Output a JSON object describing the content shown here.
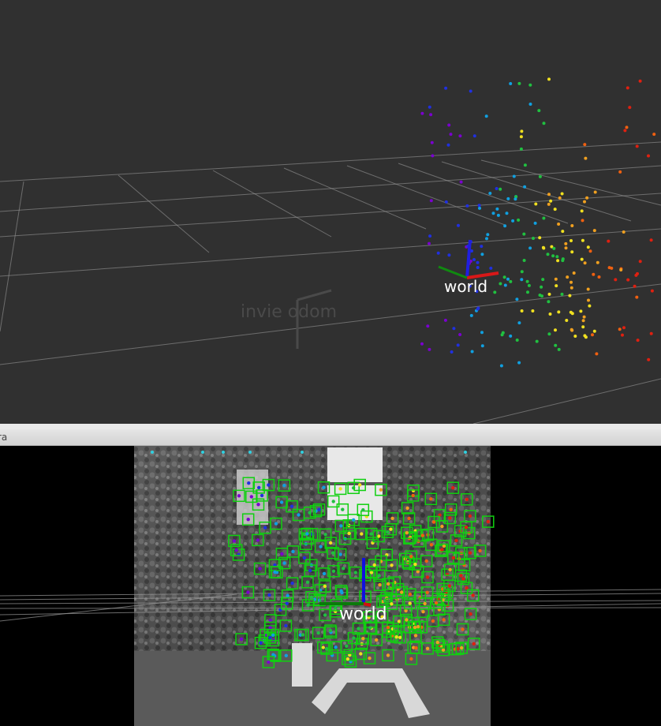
{
  "viewport": {
    "background": "#303030",
    "grid_color": "#a0a0a0",
    "watermark_text": "invie  odom",
    "frame_label": "world",
    "axis_colors": {
      "x": "#e01010",
      "y": "#10a010",
      "z": "#1010e0"
    },
    "point_palette": [
      "#7a00d0",
      "#2030e0",
      "#10a0e0",
      "#20c040",
      "#f0e020",
      "#f0a020",
      "#f06010",
      "#e02010"
    ]
  },
  "camera": {
    "title": "ra",
    "frame_label": "world",
    "feature_box_color": "#10d010",
    "background": "#000000"
  }
}
